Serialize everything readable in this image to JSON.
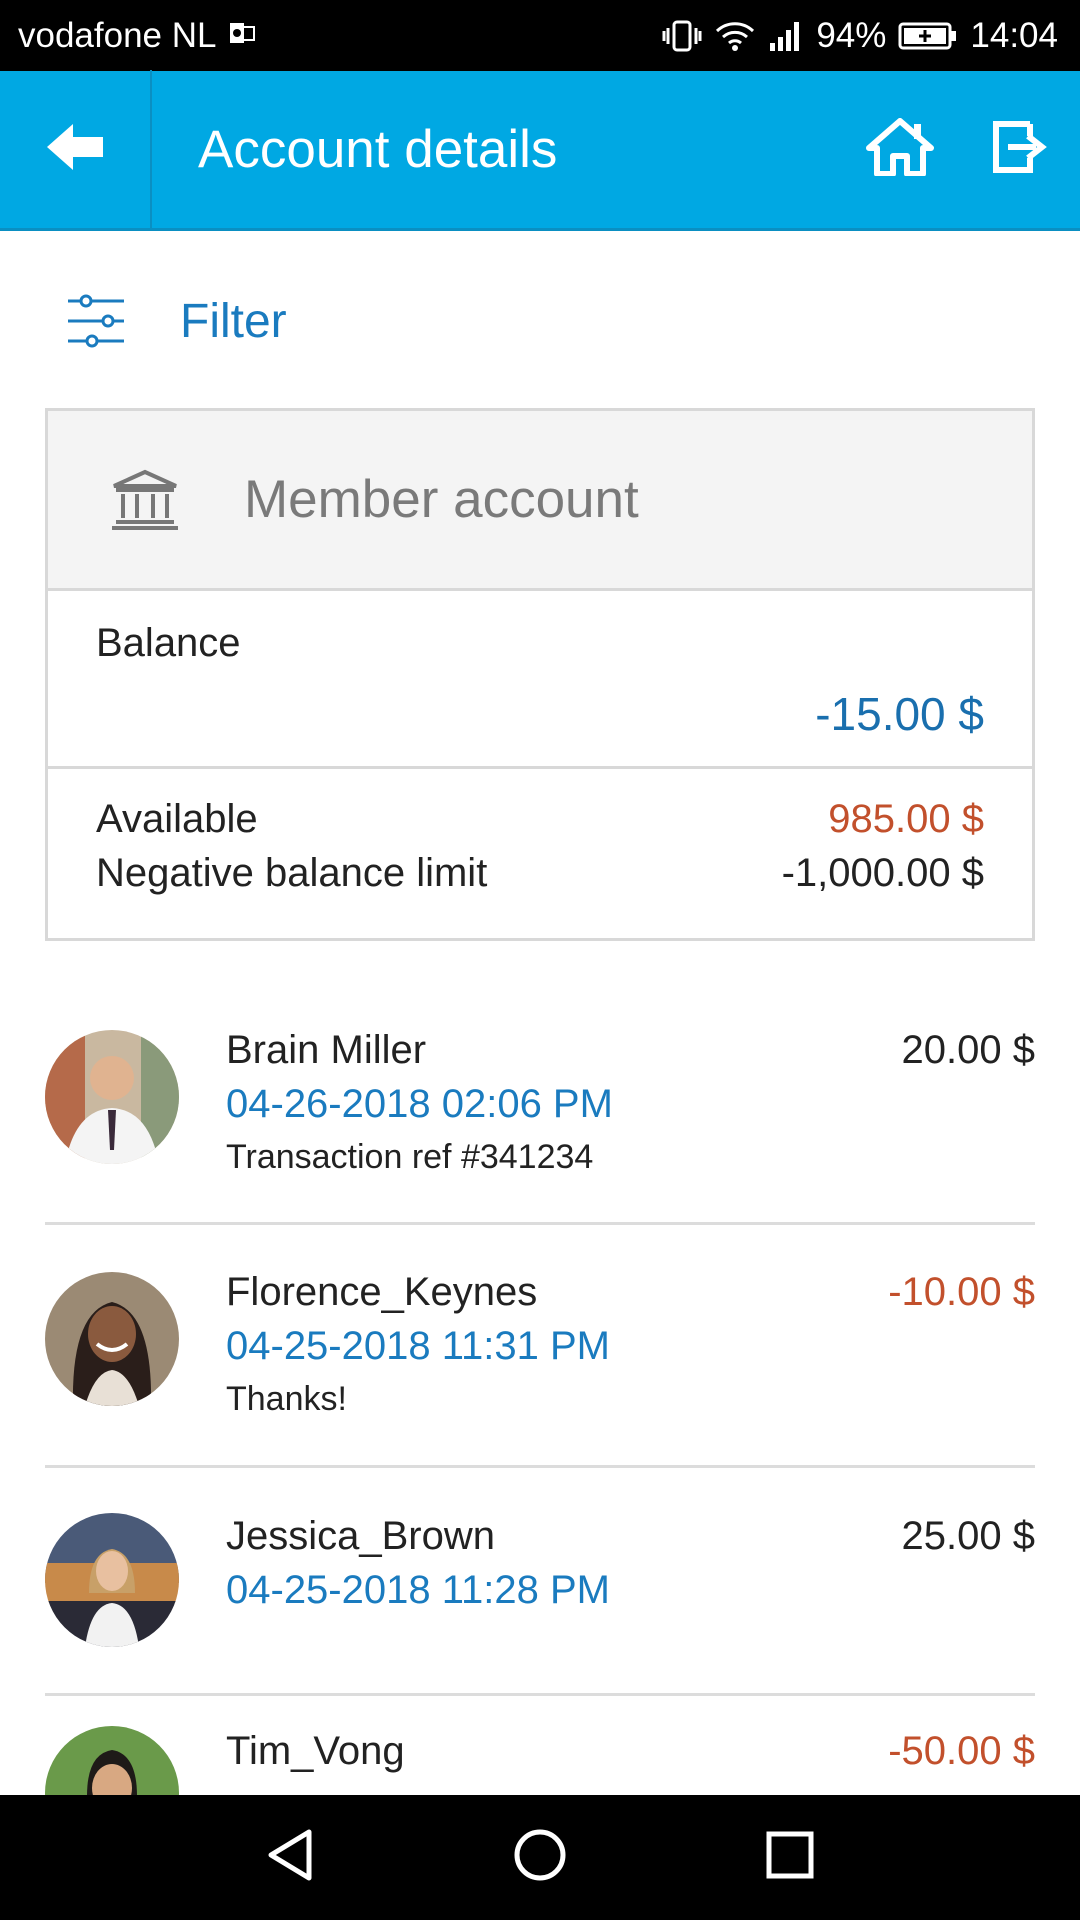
{
  "status_bar": {
    "carrier": "vodafone NL",
    "battery": "94%",
    "time": "14:04"
  },
  "app_bar": {
    "title": "Account details",
    "back_icon": "back-arrow-icon",
    "home_icon": "home-icon",
    "logout_icon": "logout-icon",
    "color": "#00a8e3"
  },
  "filter": {
    "label": "Filter",
    "icon": "sliders-icon"
  },
  "account": {
    "name": "Member account",
    "icon": "bank-icon",
    "balance_label": "Balance",
    "balance_value": "-15.00 $",
    "available_label": "Available",
    "available_value": "985.00 $",
    "limit_label": "Negative balance limit",
    "limit_value": "-1,000.00 $"
  },
  "transactions": [
    {
      "name": "Brain Miller",
      "date": "04-26-2018 02:06 PM",
      "description": "Transaction ref #341234",
      "amount": "20.00 $"
    },
    {
      "name": "Florence_Keynes",
      "date": "04-25-2018 11:31 PM",
      "description": "Thanks!",
      "amount": "-10.00 $"
    },
    {
      "name": "Jessica_Brown",
      "date": "04-25-2018 11:28 PM",
      "description": "",
      "amount": "25.00 $"
    },
    {
      "name": "Tim_Vong",
      "date": "",
      "description": "",
      "amount": "-50.00 $"
    }
  ],
  "colors": {
    "accent": "#00a8e3",
    "link": "#1a7bbf",
    "negative": "#c2502c"
  }
}
